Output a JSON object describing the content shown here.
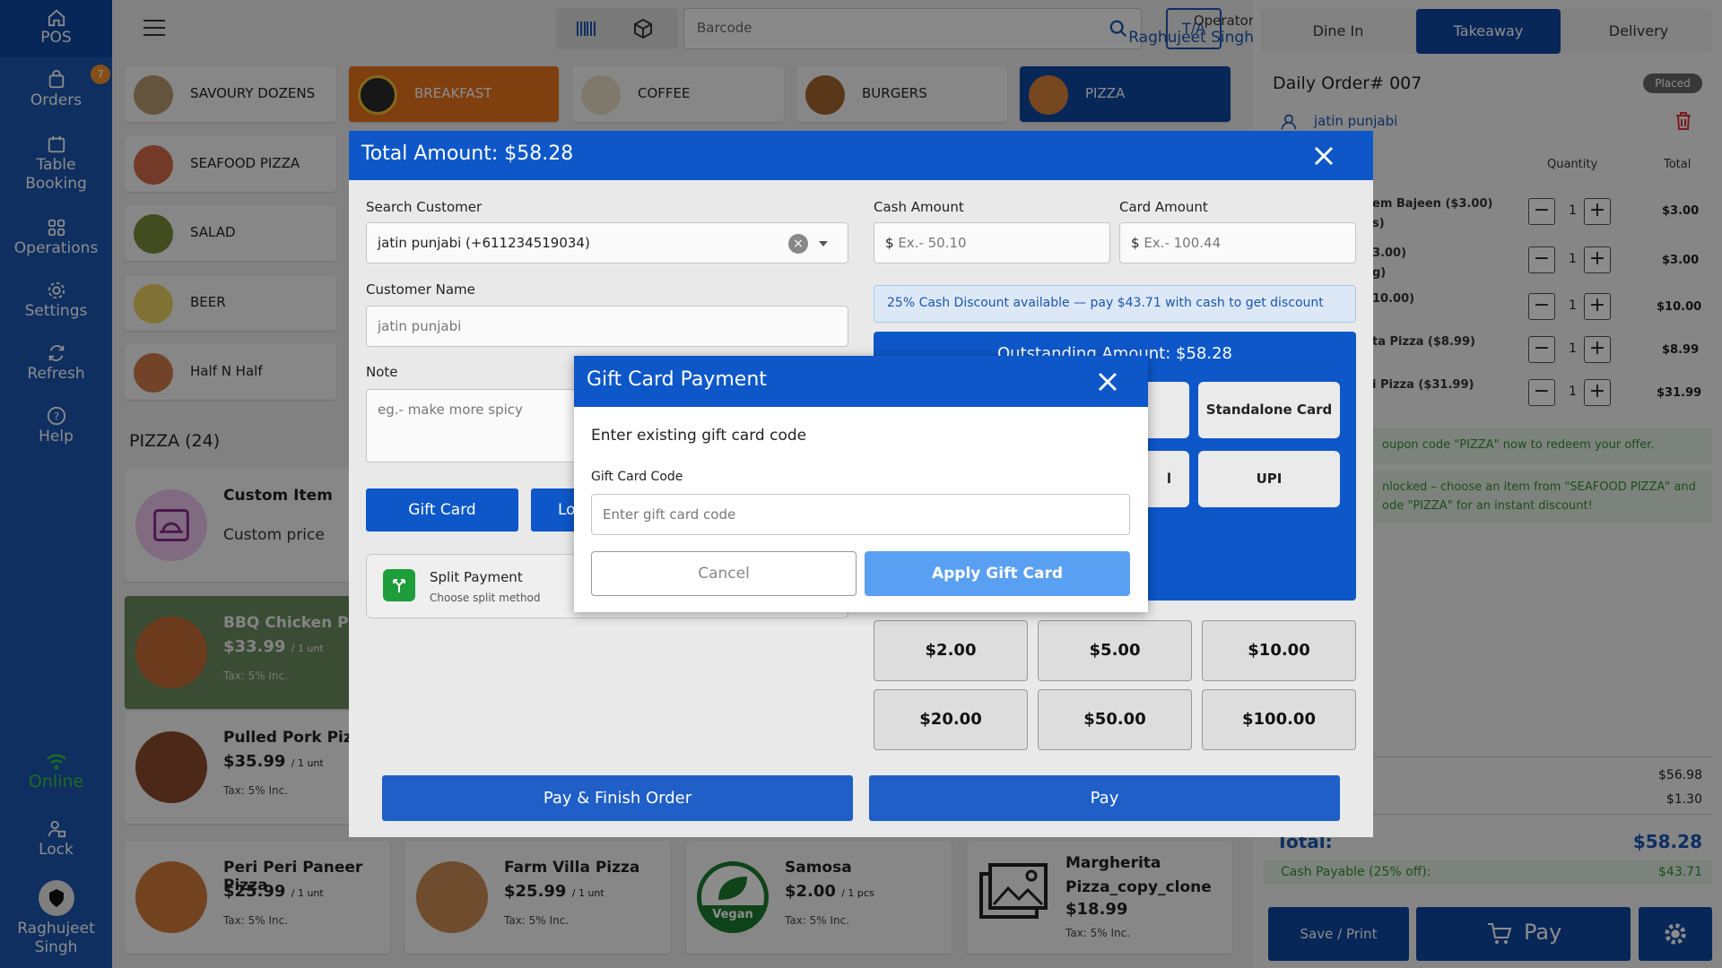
{
  "nav": {
    "pos": "POS",
    "orders": "Orders",
    "orders_badge": "7",
    "table_booking_1": "Table",
    "table_booking_2": "Booking",
    "operations": "Operations",
    "settings": "Settings",
    "refresh": "Refresh",
    "help": "Help",
    "online": "Online",
    "lock": "Lock",
    "user_1": "Raghujeet",
    "user_2": "Singh"
  },
  "topbar": {
    "search_placeholder": "Barcode",
    "ta": "T/A",
    "operator_label": "Operator",
    "operator_name": "Raghujeet Singh"
  },
  "categories": [
    {
      "name": "SAVOURY DOZENS"
    },
    {
      "name": "BREAKFAST"
    },
    {
      "name": "COFFEE"
    },
    {
      "name": "BURGERS"
    },
    {
      "name": "PIZZA"
    },
    {
      "name": "SEAFOOD PIZZA"
    },
    {
      "name": "SALAD"
    },
    {
      "name": "BEER"
    },
    {
      "name": "Half N Half"
    }
  ],
  "section_title": "PIZZA (24)",
  "items": [
    {
      "name": "Custom Item",
      "sub": "Custom price"
    },
    {
      "name": "BBQ Chicken Pizz",
      "price": "$33.99",
      "unit": "/ 1 unt",
      "tax": "Tax: 5% Inc."
    },
    {
      "name": "Pulled Pork Pizza",
      "price": "$35.99",
      "unit": "/ 1 unt",
      "tax": "Tax: 5% Inc."
    },
    {
      "name": "Peri Peri Paneer Pizza",
      "price": "$25.99",
      "unit": "/ 1 unt",
      "tax": "Tax: 5% Inc."
    },
    {
      "name": "Farm Villa Pizza",
      "price": "$25.99",
      "unit": "/ 1 unt",
      "tax": "Tax: 5% Inc."
    },
    {
      "name": "Samosa",
      "price": "$2.00",
      "unit": "/ 1 pcs",
      "tax": "Tax: 5% Inc.",
      "badge": "Vegan"
    },
    {
      "name1": "Margherita",
      "name2": "Pizza_copy_clone",
      "price": "$18.99",
      "tax": "Tax: 5% Inc."
    }
  ],
  "order": {
    "tabs": [
      "Dine In",
      "Takeaway",
      "Delivery"
    ],
    "title": "Daily Order# 007",
    "status": "Placed",
    "customer": "jatin punjabi",
    "col_qty": "Quantity",
    "col_total": "Total",
    "lines": [
      {
        "l1": "em Bajeen ($3.00)",
        "l2": "s)",
        "qty": "1",
        "total": "$3.00"
      },
      {
        "l1": "3.00)",
        "l2": "g)",
        "qty": "1",
        "total": "$3.00"
      },
      {
        "l1": "10.00)",
        "l2": "",
        "qty": "1",
        "total": "$10.00"
      },
      {
        "l1": "ta Pizza ($8.99)",
        "l2": "",
        "qty": "1",
        "total": "$8.99"
      },
      {
        "l1": "i Pizza ($31.99)",
        "l2": "",
        "qty": "1",
        "total": "$31.99"
      }
    ],
    "promo1": "oupon code \"PIZZA\" now to redeem your offer.",
    "promo2a": "nlocked – choose an item from \"SEAFOOD PIZZA\" and",
    "promo2b": "ode \"PIZZA\" for an instant discount!",
    "subtotal": "$56.98",
    "tax": "$1.30",
    "total_label": "Total:",
    "total": "$58.28",
    "cash_label": "Cash Payable (25% off):",
    "cash_value": "$43.71",
    "save_print": "Save / Print",
    "pay": "Pay"
  },
  "payment_modal": {
    "title": "Total Amount: $58.28",
    "search_customer_label": "Search Customer",
    "search_customer_value": "jatin punjabi (+611234519034)",
    "customer_name_label": "Customer Name",
    "customer_name_value": "jatin punjabi",
    "note_label": "Note",
    "note_placeholder": "eg.- make more spicy",
    "gift_card_btn": "Gift Card",
    "loyalty_btn": "Lo",
    "split_title": "Split Payment",
    "split_sub": "Choose split method",
    "cash_amount_label": "Cash Amount",
    "cash_placeholder": "Ex.- 50.10",
    "card_amount_label": "Card Amount",
    "card_placeholder": "Ex.- 100.44",
    "currency": "$",
    "discount_note": "25% Cash Discount available — pay $43.71 with cash to get discount",
    "outstanding": "Outstanding Amount: $58.28",
    "method_standalone": "Standalone Card",
    "method_partial": "l",
    "method_upi": "UPI",
    "amounts": [
      "$2.00",
      "$5.00",
      "$10.00",
      "$20.00",
      "$50.00",
      "$100.00"
    ],
    "pay_finish": "Pay & Finish Order",
    "pay": "Pay"
  },
  "gift_dialog": {
    "title": "Gift Card Payment",
    "subtitle": "Enter existing gift card code",
    "code_label": "Gift Card Code",
    "code_placeholder": "Enter gift card code",
    "cancel": "Cancel",
    "apply": "Apply Gift Card"
  },
  "colors": {
    "primary": "#0d57c9",
    "nav": "#1a56b0",
    "breakfast": "#e8741c",
    "online": "#3fbf3f",
    "success_text": "#3a8a3a"
  }
}
